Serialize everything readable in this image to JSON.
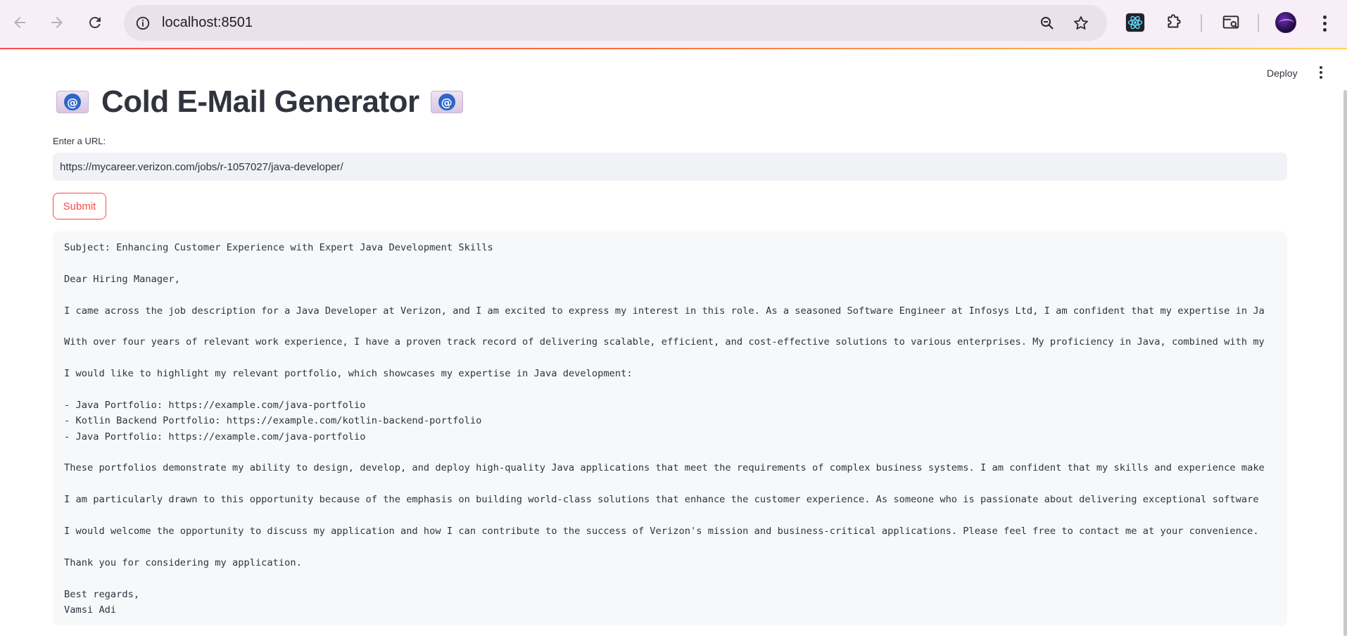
{
  "browser": {
    "url": "localhost:8501",
    "icons": [
      "back-arrow-icon",
      "forward-arrow-icon",
      "reload-icon",
      "site-info-icon",
      "zoom-icon",
      "bookmark-star-icon",
      "react-devtools-icon",
      "extensions-puzzle-icon",
      "tab-search-icon",
      "profile-avatar",
      "browser-menu-icon"
    ]
  },
  "app": {
    "toolbar": {
      "deploy_label": "Deploy"
    },
    "title": "Cold E-Mail Generator",
    "title_emoji": "email-at-icon",
    "url_field": {
      "label": "Enter a URL:",
      "value": "https://mycareer.verizon.com/jobs/r-1057027/java-developer/"
    },
    "submit_label": "Submit",
    "email_lines": [
      "Subject: Enhancing Customer Experience with Expert Java Development Skills",
      "",
      "Dear Hiring Manager,",
      "",
      "I came across the job description for a Java Developer at Verizon, and I am excited to express my interest in this role. As a seasoned Software Engineer at Infosys Ltd, I am confident that my expertise in Ja",
      "",
      "With over four years of relevant work experience, I have a proven track record of delivering scalable, efficient, and cost-effective solutions to various enterprises. My proficiency in Java, combined with my",
      "",
      "I would like to highlight my relevant portfolio, which showcases my expertise in Java development:",
      "",
      "- Java Portfolio: https://example.com/java-portfolio",
      "- Kotlin Backend Portfolio: https://example.com/kotlin-backend-portfolio",
      "- Java Portfolio: https://example.com/java-portfolio",
      "",
      "These portfolios demonstrate my ability to design, develop, and deploy high-quality Java applications that meet the requirements of complex business systems. I am confident that my skills and experience make",
      "",
      "I am particularly drawn to this opportunity because of the emphasis on building world-class solutions that enhance the customer experience. As someone who is passionate about delivering exceptional software",
      "",
      "I would welcome the opportunity to discuss my application and how I can contribute to the success of Verizon's mission and business-critical applications. Please feel free to contact me at your convenience.",
      "",
      "Thank you for considering my application.",
      "",
      "Best regards,",
      "Vamsi Adi"
    ]
  },
  "colors": {
    "accent": "#ff4b4b",
    "text": "#31333f",
    "input_bg": "#f0f2f6",
    "code_bg": "#f7f8fa",
    "chrome_bg": "#f8eef7"
  }
}
